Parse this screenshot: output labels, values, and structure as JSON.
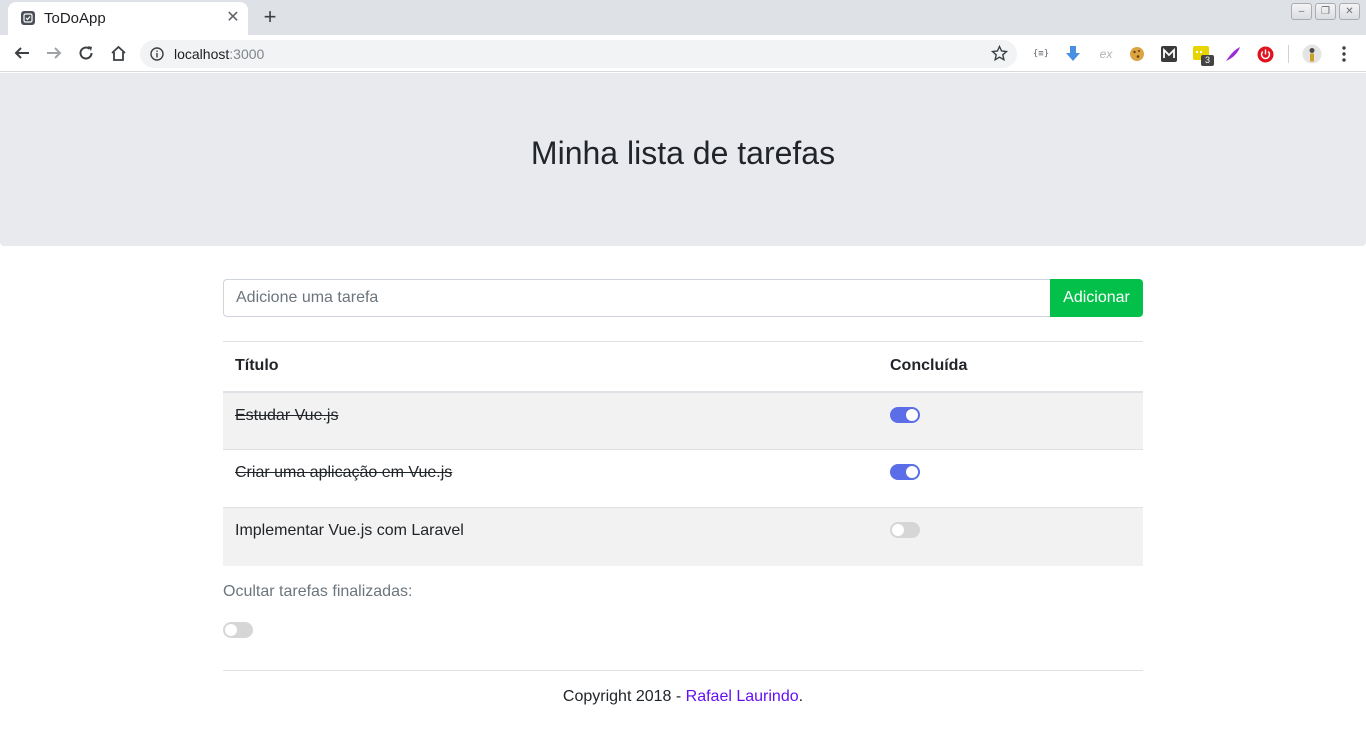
{
  "browser": {
    "tab_title": "ToDoApp",
    "tab_close": "✕",
    "new_tab": "+",
    "url_host": "localhost",
    "url_port": ":3000",
    "ext_json": "{≡}",
    "ext_ex": "ex",
    "ext_badge": "3"
  },
  "header": {
    "title": "Minha lista de tarefas"
  },
  "form": {
    "placeholder": "Adicione uma tarefa",
    "value": "",
    "add_label": "Adicionar"
  },
  "table": {
    "headers": [
      "Título",
      "Concluída"
    ],
    "rows": [
      {
        "title": "Estudar Vue.js",
        "done": true
      },
      {
        "title": "Criar uma aplicação em Vue.js",
        "done": true
      },
      {
        "title": "Implementar Vue.js com Laravel",
        "done": false
      }
    ]
  },
  "filter": {
    "label": "Ocultar tarefas finalizadas:",
    "enabled": false
  },
  "footer": {
    "prefix": "Copyright 2018 - ",
    "author": "Rafael Laurindo",
    "suffix": "."
  },
  "colors": {
    "accent": "#5b6ee8",
    "button": "#03c04a",
    "link": "#6610f2"
  }
}
